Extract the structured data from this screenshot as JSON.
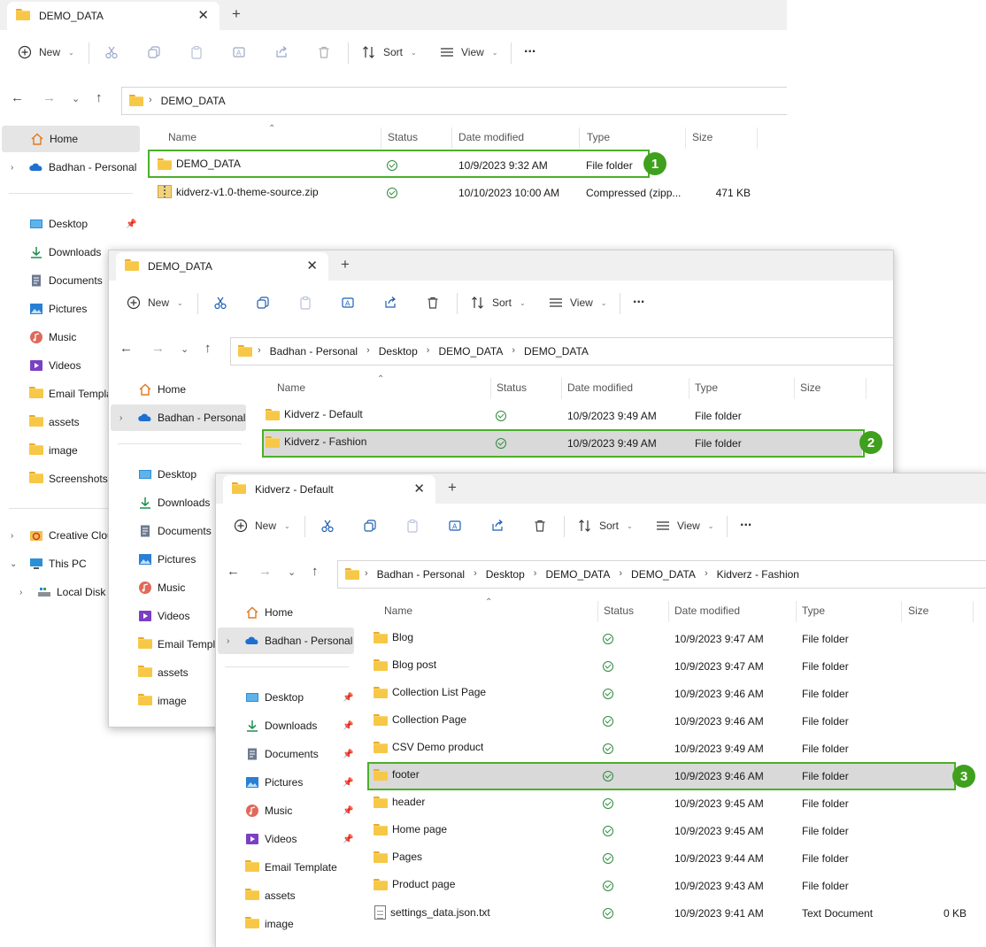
{
  "colors": {
    "accent": "#4caf2a",
    "badge": "#3fa01e",
    "status_ok": "#2e8b3d",
    "selection": "#d9d9d9"
  },
  "toolbar": {
    "new": "New",
    "sort": "Sort",
    "view": "View",
    "more": "..."
  },
  "columns": {
    "name": "Name",
    "status": "Status",
    "date": "Date modified",
    "type": "Type",
    "size": "Size"
  },
  "window1": {
    "tab_title": "DEMO_DATA",
    "breadcrumb": [
      "DEMO_DATA"
    ],
    "nav": {
      "home": "Home",
      "cloud": "Badhan - Personal",
      "desktop": "Desktop",
      "downloads": "Downloads",
      "documents": "Documents",
      "pictures": "Pictures",
      "music": "Music",
      "videos": "Videos",
      "email": "Email Templa",
      "assets": "assets",
      "image": "image",
      "screenshots": "Screenshots",
      "creative": "Creative Clou",
      "thispc": "This PC",
      "localdisk": "Local Disk ("
    },
    "files": [
      {
        "name": "DEMO_DATA",
        "date": "10/9/2023 9:32 AM",
        "type": "File folder",
        "size": "",
        "icon": "folder-icon"
      },
      {
        "name": "kidverz-v1.0-theme-source.zip",
        "date": "10/10/2023 10:00 AM",
        "type": "Compressed (zipp...",
        "size": "471 KB",
        "icon": "zip-icon"
      }
    ],
    "callout": "1"
  },
  "window2": {
    "tab_title": "DEMO_DATA",
    "breadcrumb": [
      "Badhan - Personal",
      "Desktop",
      "DEMO_DATA",
      "DEMO_DATA"
    ],
    "nav": {
      "home": "Home",
      "cloud": "Badhan - Personal",
      "desktop": "Desktop",
      "downloads": "Downloads",
      "documents": "Documents",
      "pictures": "Pictures",
      "music": "Music",
      "videos": "Videos",
      "email": "Email Templa",
      "assets": "assets",
      "image": "image"
    },
    "files": [
      {
        "name": "Kidverz - Default",
        "date": "10/9/2023 9:49 AM",
        "type": "File folder"
      },
      {
        "name": "Kidverz - Fashion",
        "date": "10/9/2023 9:49 AM",
        "type": "File folder"
      }
    ],
    "callout": "2"
  },
  "window3": {
    "tab_title": "Kidverz - Default",
    "breadcrumb": [
      "Badhan - Personal",
      "Desktop",
      "DEMO_DATA",
      "DEMO_DATA",
      "Kidverz - Fashion"
    ],
    "nav": {
      "home": "Home",
      "cloud": "Badhan - Personal",
      "desktop": "Desktop",
      "downloads": "Downloads",
      "documents": "Documents",
      "pictures": "Pictures",
      "music": "Music",
      "videos": "Videos",
      "email": "Email Template",
      "assets": "assets",
      "image": "image"
    },
    "files": [
      {
        "name": "Blog",
        "date": "10/9/2023 9:47 AM",
        "type": "File folder",
        "size": ""
      },
      {
        "name": "Blog post",
        "date": "10/9/2023 9:47 AM",
        "type": "File folder",
        "size": ""
      },
      {
        "name": "Collection List Page",
        "date": "10/9/2023 9:46 AM",
        "type": "File folder",
        "size": ""
      },
      {
        "name": "Collection Page",
        "date": "10/9/2023 9:46 AM",
        "type": "File folder",
        "size": ""
      },
      {
        "name": "CSV Demo product",
        "date": "10/9/2023 9:49 AM",
        "type": "File folder",
        "size": ""
      },
      {
        "name": "footer",
        "date": "10/9/2023 9:46 AM",
        "type": "File folder",
        "size": ""
      },
      {
        "name": "header",
        "date": "10/9/2023 9:45 AM",
        "type": "File folder",
        "size": ""
      },
      {
        "name": "Home page",
        "date": "10/9/2023 9:45 AM",
        "type": "File folder",
        "size": ""
      },
      {
        "name": "Pages",
        "date": "10/9/2023 9:44 AM",
        "type": "File folder",
        "size": ""
      },
      {
        "name": "Product page",
        "date": "10/9/2023 9:43 AM",
        "type": "File folder",
        "size": ""
      },
      {
        "name": "settings_data.json.txt",
        "date": "10/9/2023 9:41 AM",
        "type": "Text Document",
        "size": "0 KB"
      }
    ],
    "callout": "3"
  }
}
